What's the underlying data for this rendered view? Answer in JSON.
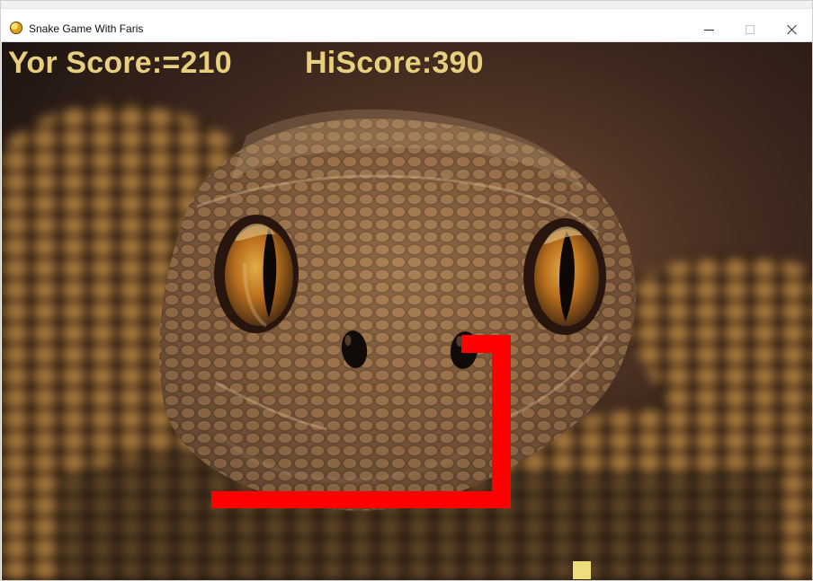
{
  "window": {
    "title": "Snake Game With Faris"
  },
  "hud": {
    "score_label": "Yor Score:=210",
    "hiscore_label": "HiScore:390",
    "text_color": "#e8cf7e"
  },
  "game": {
    "score": 210,
    "hiscore": 390,
    "snake_color": "#ff0000",
    "food_color": "#eedd7a"
  },
  "icons": {
    "app": "pygame-snake-icon",
    "minimize": "minimize-icon",
    "maximize": "maximize-icon",
    "close": "close-icon"
  }
}
